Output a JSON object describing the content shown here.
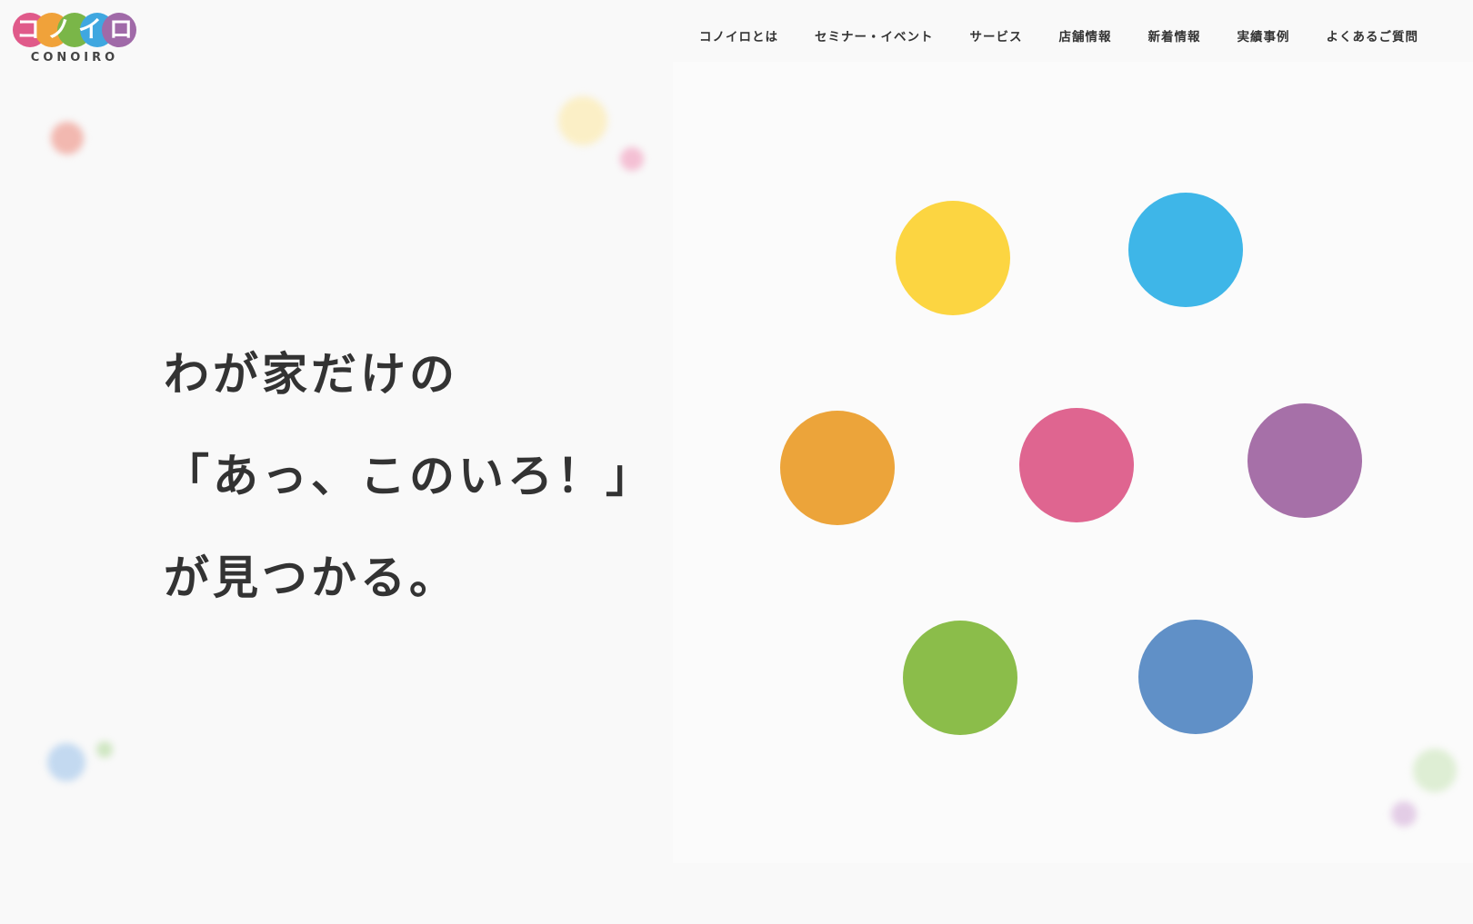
{
  "logo": {
    "glyphs": [
      "コ",
      "ノ",
      "イ",
      "ロ"
    ],
    "subtitle": "CONOIRO",
    "colors": [
      "#e05a8a",
      "#f0a23a",
      "#7ab648",
      "#3fa7e0",
      "#a06aa8"
    ]
  },
  "nav": {
    "items": [
      {
        "label": "コノイロとは"
      },
      {
        "label": "セミナー・イベント"
      },
      {
        "label": "サービス"
      },
      {
        "label": "店舗情報"
      },
      {
        "label": "新着情報"
      },
      {
        "label": "実績事例"
      },
      {
        "label": "よくあるご質問"
      }
    ]
  },
  "hero": {
    "line1": "わが家だけの",
    "line2": "「あっ、このいろ！」",
    "line3": "が見つかる。"
  },
  "colors": {
    "yellow": "#fcd541",
    "sky": "#3eb6e8",
    "orange": "#eca43a",
    "pink": "#df6590",
    "purple": "#a670a8",
    "green": "#8bbd4a",
    "blue": "#6090c7",
    "text": "#333333",
    "background": "#f9f9f9"
  }
}
